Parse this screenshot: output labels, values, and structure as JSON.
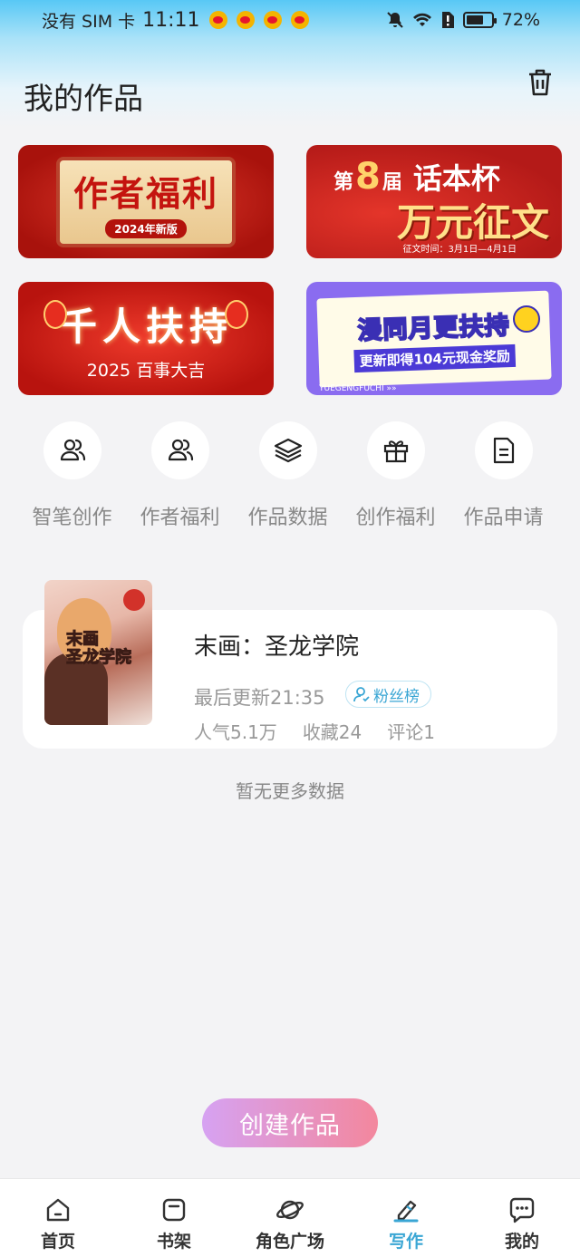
{
  "status_bar": {
    "carrier": "没有 SIM 卡",
    "time": "11:11",
    "battery": "72%",
    "battery_level": 0.72
  },
  "header": {
    "title": "我的作品"
  },
  "banners": [
    {
      "title": "作者福利",
      "subtitle": "2024年新版"
    },
    {
      "prefix": "第",
      "number": "8",
      "suffix": "届",
      "highlight": "话本杯",
      "main": "万元征文",
      "footnote": "征文时间：3月1日—4月1日"
    },
    {
      "title": "千人扶持",
      "subtitle": "2025 百事大吉"
    },
    {
      "title": "漫同月更扶持",
      "subtitle": "更新即得104元现金奖励",
      "footnote": "YUEGENGFUCHI »»"
    }
  ],
  "quick_actions": [
    {
      "label": "智笔创作",
      "icon": "users-icon"
    },
    {
      "label": "作者福利",
      "icon": "users-icon"
    },
    {
      "label": "作品数据",
      "icon": "layers-icon"
    },
    {
      "label": "创作福利",
      "icon": "gift-icon"
    },
    {
      "label": "作品申请",
      "icon": "document-icon"
    }
  ],
  "work": {
    "cover_text": "末画\n圣龙学院",
    "title": "末画：圣龙学院",
    "last_update": "最后更新21:35",
    "fan_badge": "粉丝榜",
    "popularity": "人气5.1万",
    "favorites": "收藏24",
    "comments": "评论1"
  },
  "no_more": "暂无更多数据",
  "create_button": "创建作品",
  "tabs": [
    {
      "label": "首页",
      "icon": "home-icon"
    },
    {
      "label": "书架",
      "icon": "bookshelf-icon"
    },
    {
      "label": "角色广场",
      "icon": "planet-icon"
    },
    {
      "label": "写作",
      "icon": "pen-icon",
      "active": true
    },
    {
      "label": "我的",
      "icon": "chat-icon"
    }
  ],
  "colors": {
    "accent": "#3aa6d4",
    "create_start": "#d6a2f2",
    "create_end": "#f3879d"
  }
}
